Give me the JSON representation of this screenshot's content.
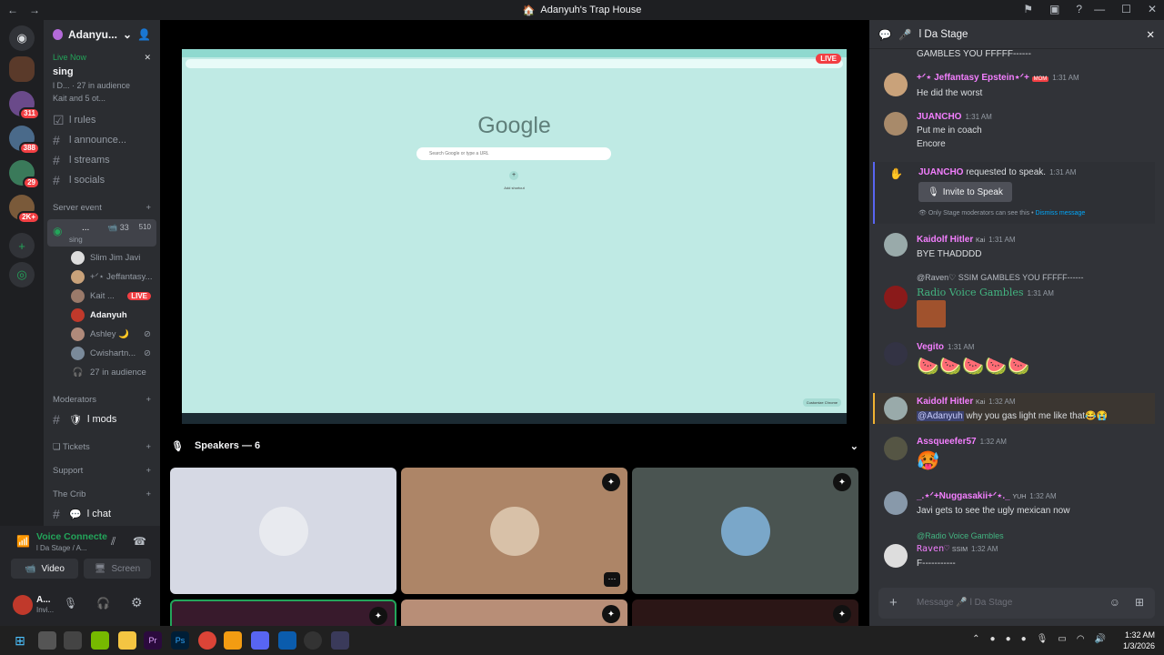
{
  "window": {
    "title": "Adanyuh's Trap House"
  },
  "server": {
    "name": "Adanyu...",
    "badges": [
      "311",
      "388",
      "29",
      "2K+"
    ]
  },
  "live_now": {
    "label": "Live Now",
    "stream_name": "sing",
    "info": "l D... · 27 in audience",
    "speakers": "Kait and 5 ot..."
  },
  "channels": [
    {
      "name": "l rules",
      "icon": "checkbox"
    },
    {
      "name": "l announce...",
      "icon": "megaphone"
    },
    {
      "name": "l streams",
      "icon": "hash"
    },
    {
      "name": "l socials",
      "icon": "hash"
    }
  ],
  "categories": {
    "server_event": "Server event",
    "moderators": "Moderators",
    "tickets": "❏ Tickets",
    "support": "Support",
    "the_crib": "The Crib"
  },
  "stage": {
    "name": "...",
    "sub": "sing",
    "count_video": "33",
    "count_listeners": "510"
  },
  "voice_users": [
    {
      "name": "Slim Jim Javi"
    },
    {
      "name": "+ᐟ⋆ Jeffantasy..."
    },
    {
      "name": "Kait ...",
      "live": "LIVE"
    },
    {
      "name": "Adanyuh"
    },
    {
      "name": "Ashley 🌙"
    },
    {
      "name": "Cwishartn..."
    },
    {
      "name": "27 in audience"
    }
  ],
  "mods_channel": "l mods",
  "chat_channel": "l chat",
  "voice_status": {
    "title": "Voice Connecte",
    "sub": "l Da Stage / A...",
    "video_btn": "Video",
    "screen_btn": "Screen"
  },
  "user": {
    "name": "A...",
    "status": "Invi..."
  },
  "speakers_header": "Speakers — 6",
  "screenshare": {
    "live": "LIVE",
    "logo": "Google",
    "search_placeholder": "Search Google or type a URL",
    "shortcut": "Add shortcut",
    "customize": "Customize Chrome"
  },
  "chat": {
    "header": "l Da Stage",
    "top_line": "GAMBLES YOU FFFFF------",
    "messages": [
      {
        "name": "+ᐟ⋆ Jeffantasy Epstein⋆ᐟ+",
        "tag": "MOM",
        "time": "1:31 AM",
        "text": "He did the worst",
        "color": "#f47fff"
      },
      {
        "name": "JUANCHO",
        "time": "1:31 AM",
        "text": "Put me in coach",
        "text2": "Encore",
        "color": "#f47fff"
      },
      {
        "name": "JUANCHO",
        "time": "1:31 AM",
        "text": "requested to speak.",
        "color": "#f47fff"
      },
      {
        "name": "Kaidolf Hitler",
        "tag": "Kai",
        "time": "1:31 AM",
        "text": "BYE THADDDD",
        "color": "#f47fff"
      },
      {
        "name": "Radio Voice Gambles",
        "reply": "@Raven♡ SSIM GAMBLES YOU FFFFF------",
        "time": "1:31 AM",
        "color": "#43b581"
      },
      {
        "name": "Vegito",
        "time": "1:31 AM",
        "text": "🍉🍉🍉🍉🍉",
        "color": "#f47fff"
      },
      {
        "name": "Kaidolf Hitler",
        "tag": "Kai",
        "time": "1:32 AM",
        "mention": "@Adanyuh",
        "text": " why you gas light me like that😂😭",
        "color": "#f47fff"
      },
      {
        "name": "Assqueefer57",
        "time": "1:32 AM",
        "text": "🥵",
        "color": "#f47fff"
      },
      {
        "name": "_.⋆ᐟ+Nuggasakii+ᐟ⋆._",
        "tag": "YUH",
        "time": "1:32 AM",
        "text": "Javi gets to see the ugly mexican now",
        "color": "#f47fff"
      },
      {
        "name": "Raven♡",
        "tag": "SSIM",
        "reply": "@Radio Voice Gambles",
        "time": "1:32 AM",
        "text": "F-----------",
        "color": "#f47fff"
      }
    ],
    "invite_btn": "Invite to Speak",
    "mod_note": "Only Stage moderators can see this •",
    "dismiss": "Dismiss message",
    "input_placeholder": "Message 🎤 l Da Stage"
  },
  "taskbar": {
    "time": "1:32 AM",
    "date": "1/3/2026"
  }
}
